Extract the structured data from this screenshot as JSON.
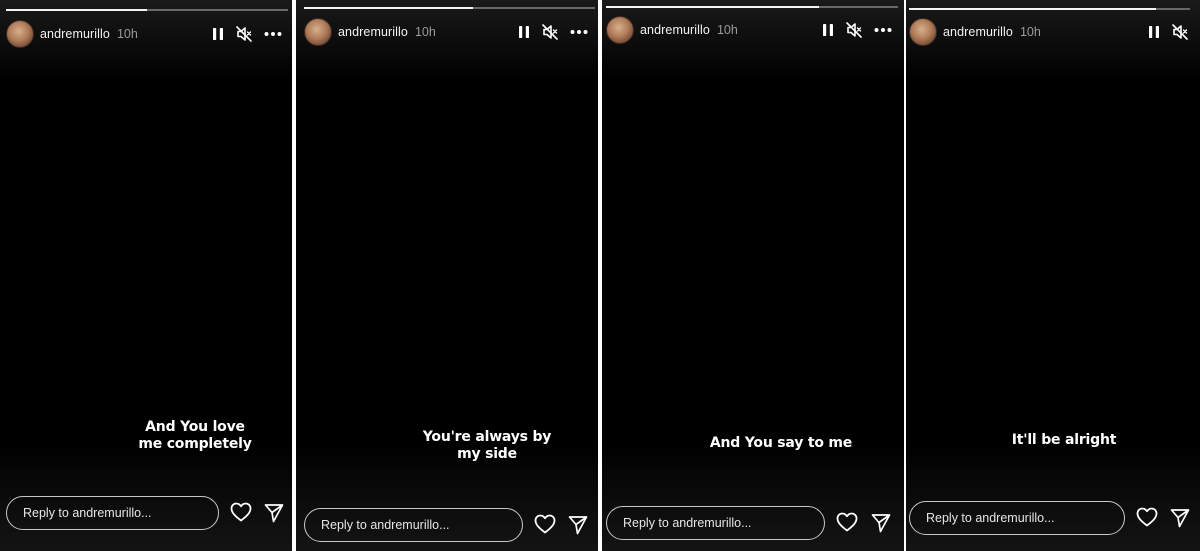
{
  "stories": [
    {
      "username": "andremurillo",
      "time": "10h",
      "progress": 0.5,
      "caption_line1": "And You love",
      "caption_line2": "me completely",
      "reply_placeholder": "Reply to andremurillo..."
    },
    {
      "username": "andremurillo",
      "time": "10h",
      "progress": 0.58,
      "caption_line1": "You're always by",
      "caption_line2": "my side",
      "reply_placeholder": "Reply to andremurillo..."
    },
    {
      "username": "andremurillo",
      "time": "10h",
      "progress": 0.73,
      "caption_line1": "And You say to me",
      "caption_line2": "",
      "reply_placeholder": "Reply to andremurillo..."
    },
    {
      "username": "andremurillo",
      "time": "10h",
      "progress": 0.88,
      "caption_line1": "It'll be alright",
      "caption_line2": "",
      "reply_placeholder": "Reply to andremurillo..."
    }
  ],
  "icons": {
    "pause": "pause-icon",
    "mute": "muted-speaker-icon",
    "more": "more-options-icon",
    "like": "heart-icon",
    "share": "send-icon"
  },
  "colors": {
    "background": "#000000",
    "text": "#ffffff",
    "progress_fill": "#f5f5f5",
    "reply_border": "#c8c8c8"
  }
}
